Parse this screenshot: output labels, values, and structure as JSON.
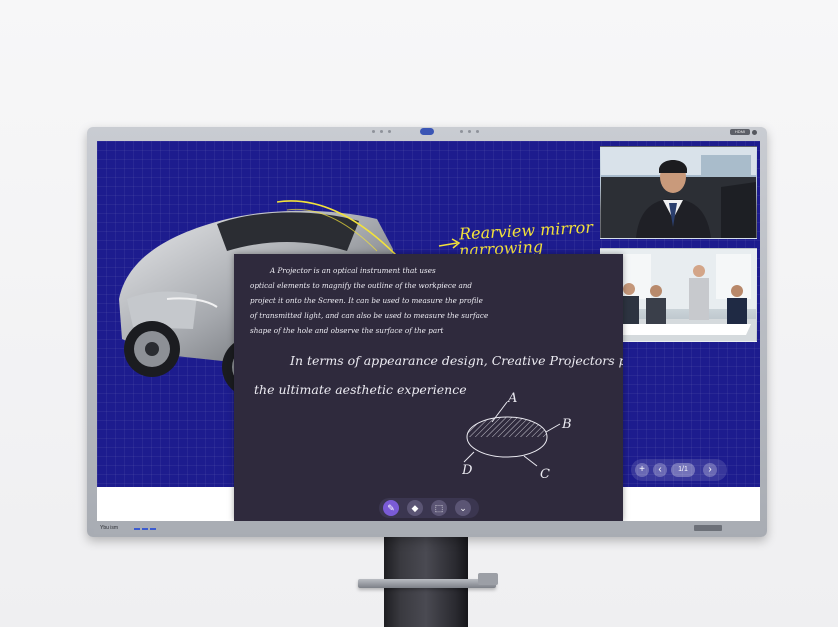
{
  "monitor": {
    "brand_label": "Ybu ism",
    "bezel_badge": "HDMI"
  },
  "slide": {
    "annotation_line1": "Rearview mirror",
    "annotation_line2": "narrowing"
  },
  "whiteboard": {
    "paragraph_lines": [
      "A Projector is an optical instrument that uses",
      "optical elements to magnify the outline of the workpiece and",
      "project it onto the Screen. It can be used to measure the profile",
      "of transmitted light, and can also be used to measure the surface",
      "shape of the hole and observe the surface of the part"
    ],
    "headline_line1": "In terms of appearance design, Creative Projectors pursue",
    "headline_line2": "the ultimate aesthetic experience",
    "diagram_labels": {
      "a": "A",
      "b": "B",
      "c": "C",
      "d": "D"
    }
  },
  "toolbar": {
    "pen_icon": "✎",
    "eraser_icon": "◆",
    "select_icon": "⬚",
    "more_icon": "⌄"
  },
  "page_nav": {
    "add_icon": "+",
    "prev_icon": "‹",
    "page_indicator": "1/1",
    "next_icon": "›"
  }
}
